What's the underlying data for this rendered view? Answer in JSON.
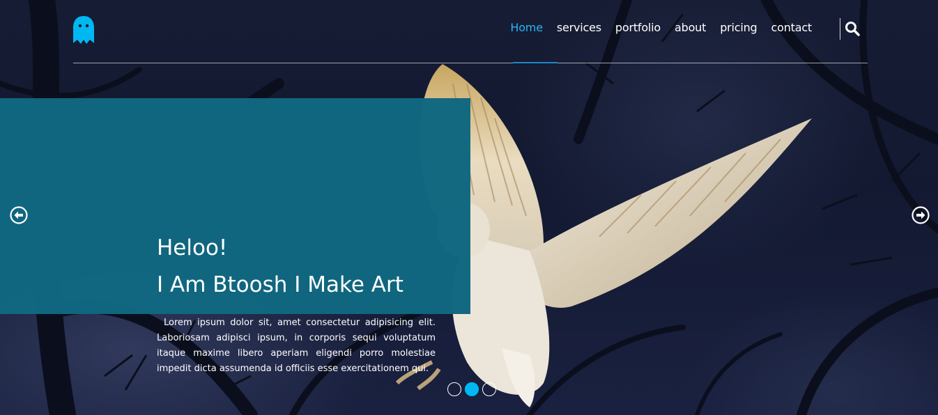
{
  "brand": {
    "logo_icon": "ghost-icon",
    "accent": "#00b7f1"
  },
  "nav": {
    "items": [
      {
        "label": "Home",
        "active": true
      },
      {
        "label": "services",
        "active": false
      },
      {
        "label": "portfolio",
        "active": false
      },
      {
        "label": "about",
        "active": false
      },
      {
        "label": "pricing",
        "active": false
      },
      {
        "label": "contact",
        "active": false
      }
    ],
    "search_icon": "search-icon"
  },
  "slider": {
    "greeting": "Heloo!",
    "tagline": "I Am Btoosh I Make Art",
    "description": "Lorem ipsum dolor sit, amet consectetur adipisicing elit. Laboriosam adipisci ipsum, in corporis sequi voluptatum itaque maxime libero aperiam eligendi porro molestiae impedit dicta assumenda id officiis esse exercitationem qui.",
    "prev_icon": "arrow-circle-left-icon",
    "next_icon": "arrow-circle-right-icon",
    "slide_count": 3,
    "active_slide": 2
  }
}
